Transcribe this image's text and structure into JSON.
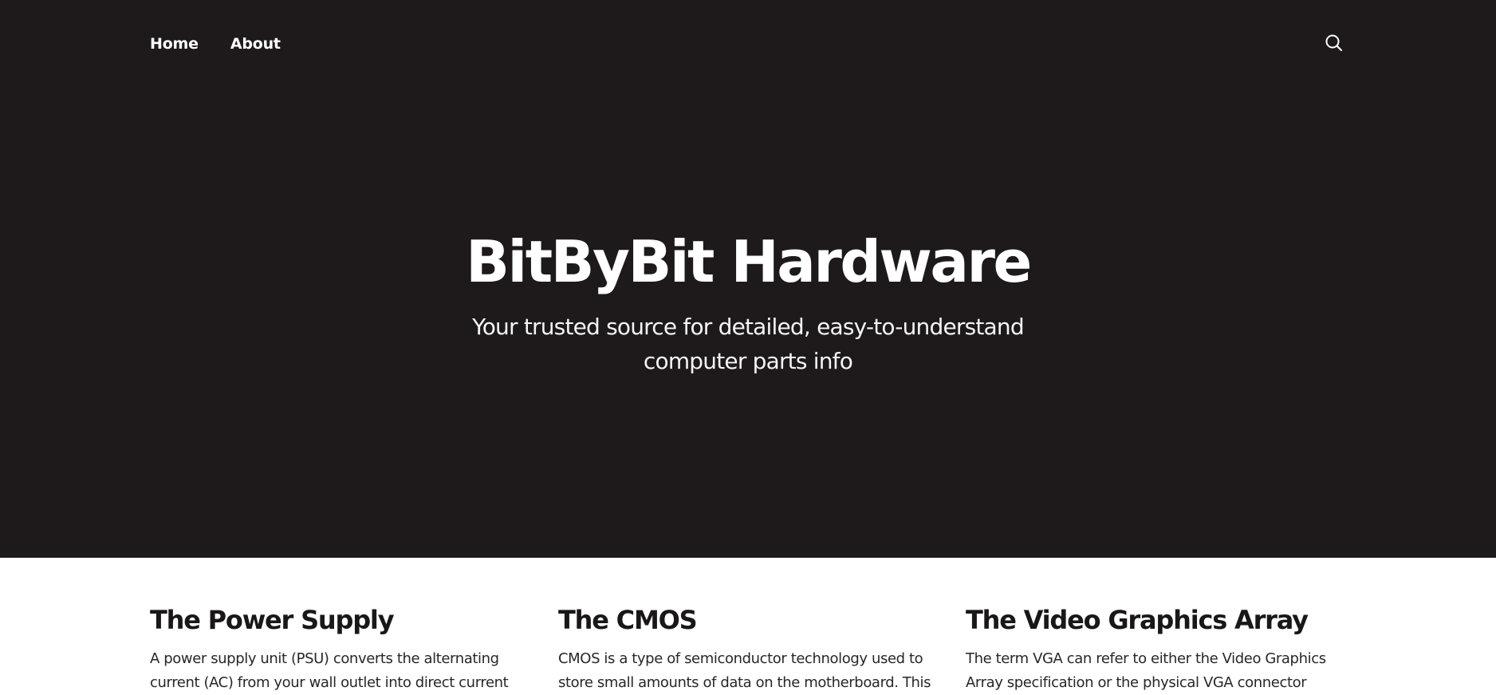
{
  "nav": {
    "items": [
      {
        "label": "Home"
      },
      {
        "label": "About"
      }
    ],
    "search_icon": "search-icon"
  },
  "hero": {
    "title": "BitByBit Hardware",
    "subtitle": "Your trusted source for detailed, easy-to-understand computer parts info"
  },
  "cards": [
    {
      "title": "The Power Supply",
      "text": "A power supply unit (PSU) converts the alternating current (AC) from your wall outlet into direct current"
    },
    {
      "title": "The CMOS",
      "text": "CMOS is a type of semiconductor technology used to store small amounts of data on the motherboard. This"
    },
    {
      "title": "The Video Graphics Array",
      "text": "The term VGA can refer to either the Video Graphics Array specification or the physical VGA connector"
    }
  ],
  "colors": {
    "hero_background": "#1e1a1b",
    "hero_text": "#ffffff",
    "page_background": "#ffffff",
    "heading_text": "#1a1718"
  }
}
